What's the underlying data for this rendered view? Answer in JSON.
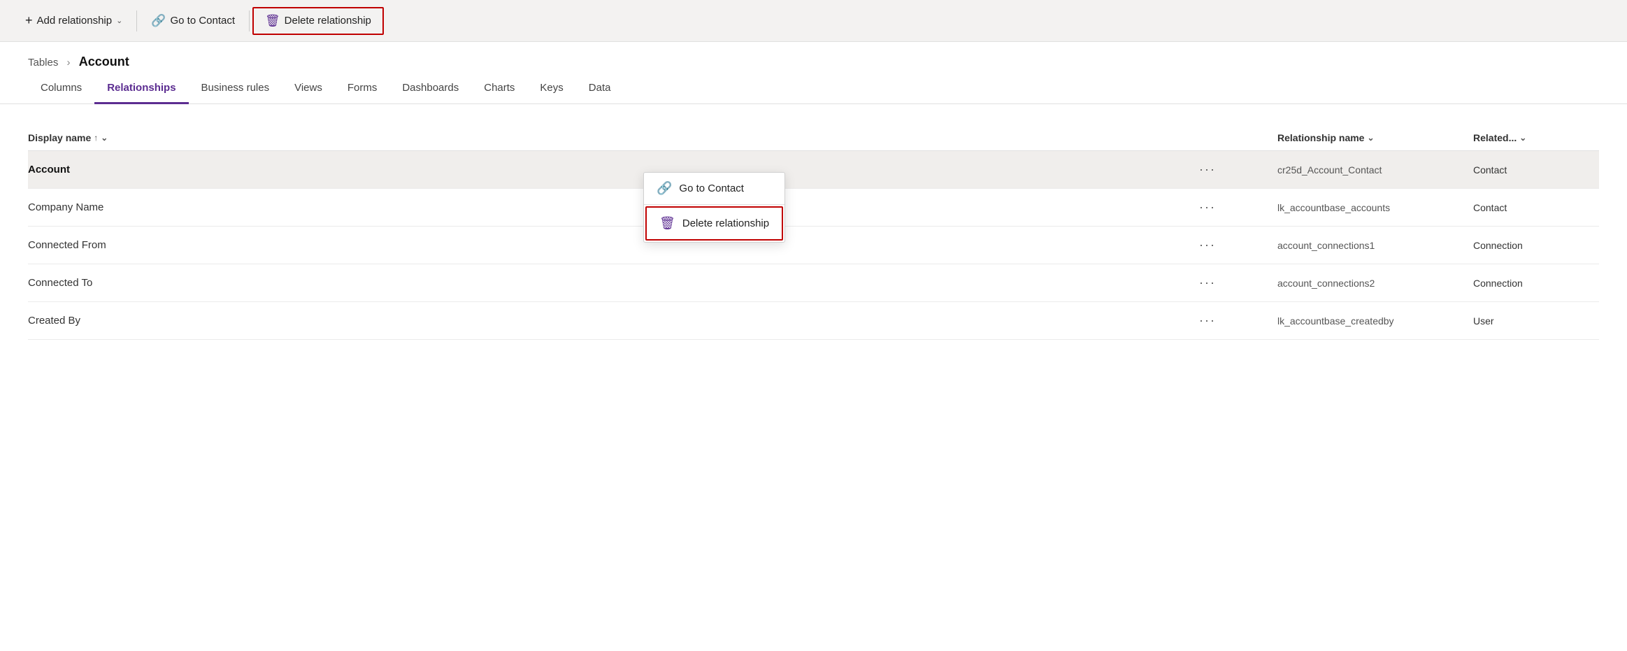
{
  "toolbar": {
    "add_relationship_label": "Add relationship",
    "go_to_contact_label": "Go to Contact",
    "delete_relationship_label": "Delete relationship"
  },
  "breadcrumb": {
    "parent": "Tables",
    "current": "Account"
  },
  "tabs": [
    {
      "id": "columns",
      "label": "Columns",
      "active": false
    },
    {
      "id": "relationships",
      "label": "Relationships",
      "active": true
    },
    {
      "id": "business-rules",
      "label": "Business rules",
      "active": false
    },
    {
      "id": "views",
      "label": "Views",
      "active": false
    },
    {
      "id": "forms",
      "label": "Forms",
      "active": false
    },
    {
      "id": "dashboards",
      "label": "Dashboards",
      "active": false
    },
    {
      "id": "charts",
      "label": "Charts",
      "active": false
    },
    {
      "id": "keys",
      "label": "Keys",
      "active": false
    },
    {
      "id": "data",
      "label": "Data",
      "active": false
    }
  ],
  "table": {
    "columns": {
      "display_name": "Display name",
      "relationship_name": "Relationship name",
      "related": "Related..."
    },
    "rows": [
      {
        "display_name": "Account",
        "bold": true,
        "selected": true,
        "dots": "···",
        "relationship_name": "cr25d_Account_Contact",
        "related": "Contact",
        "show_context_menu": true
      },
      {
        "display_name": "Company Name",
        "bold": false,
        "selected": false,
        "dots": "···",
        "relationship_name": "lk_accountbase_accounts",
        "related": "Contact",
        "show_context_menu": false
      },
      {
        "display_name": "Connected From",
        "bold": false,
        "selected": false,
        "dots": "···",
        "relationship_name": "account_connections1",
        "related": "Connection",
        "show_context_menu": false
      },
      {
        "display_name": "Connected To",
        "bold": false,
        "selected": false,
        "dots": "···",
        "relationship_name": "account_connections2",
        "related": "Connection",
        "show_context_menu": false
      },
      {
        "display_name": "Created By",
        "bold": false,
        "selected": false,
        "dots": "···",
        "relationship_name": "lk_accountbase_createdby",
        "related": "User",
        "show_context_menu": false
      }
    ]
  },
  "context_menu": {
    "go_to_contact": "Go to Contact",
    "delete_relationship": "Delete relationship"
  },
  "icons": {
    "plus": "+",
    "chevron": "∨",
    "link": "🔗",
    "trash": "🗑",
    "arrow_up": "↑",
    "arrow_down": "∨"
  }
}
